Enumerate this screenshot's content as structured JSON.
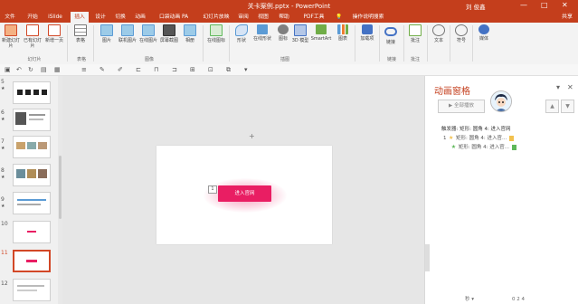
{
  "titlebar": {
    "title": "关卡案例.pptx - PowerPoint",
    "user": "刘 俊鑫",
    "minimize": "—",
    "maximize": "□",
    "close": "✕"
  },
  "tabs": [
    "文件",
    "开始",
    "iSlide",
    "插入",
    "设计",
    "切换",
    "动画",
    "口袋动画 PA",
    "幻灯片放映",
    "审阅",
    "视图",
    "帮助",
    "PDF工具",
    "操作说明搜索"
  ],
  "active_tab": "插入",
  "share": "共享",
  "ribbon": {
    "buttons": [
      "新建幻灯片",
      "已有幻灯片",
      "新增一页",
      "表格",
      "图片",
      "联机图片",
      "在线图片",
      "屏幕截图",
      "相册",
      "在线图标",
      "形状",
      "在线形状",
      "图标",
      "3D 模型",
      "SmartArt",
      "图表",
      "加载项",
      "链接",
      "批注",
      "文本",
      "符号",
      "媒体"
    ],
    "groups": [
      "幻灯片",
      "表格",
      "图像",
      "插图",
      "链接",
      "批注"
    ]
  },
  "thumbs": [
    {
      "num": "5",
      "star": "★"
    },
    {
      "num": "6",
      "star": "★"
    },
    {
      "num": "7",
      "star": "★"
    },
    {
      "num": "8",
      "star": "★"
    },
    {
      "num": "9",
      "star": "★"
    },
    {
      "num": "10",
      "star": ""
    },
    {
      "num": "11",
      "star": ""
    },
    {
      "num": "12",
      "star": ""
    }
  ],
  "slide": {
    "button_text": "进入官网",
    "tag": "1"
  },
  "pane": {
    "title": "动画窗格",
    "play": "▶ 全部播放",
    "trigger": "触发器: 矩形: 圆角 4: 进入官网",
    "items": [
      {
        "index": "1",
        "label": "矩形: 圆角 4: 进入官...",
        "color": "#f2c14e"
      },
      {
        "index": "",
        "label": "矩形: 圆角 4: 进入官...",
        "color": "#5fb85a"
      }
    ],
    "status_left": "秒 ▾",
    "status_right": "0   2   4"
  }
}
